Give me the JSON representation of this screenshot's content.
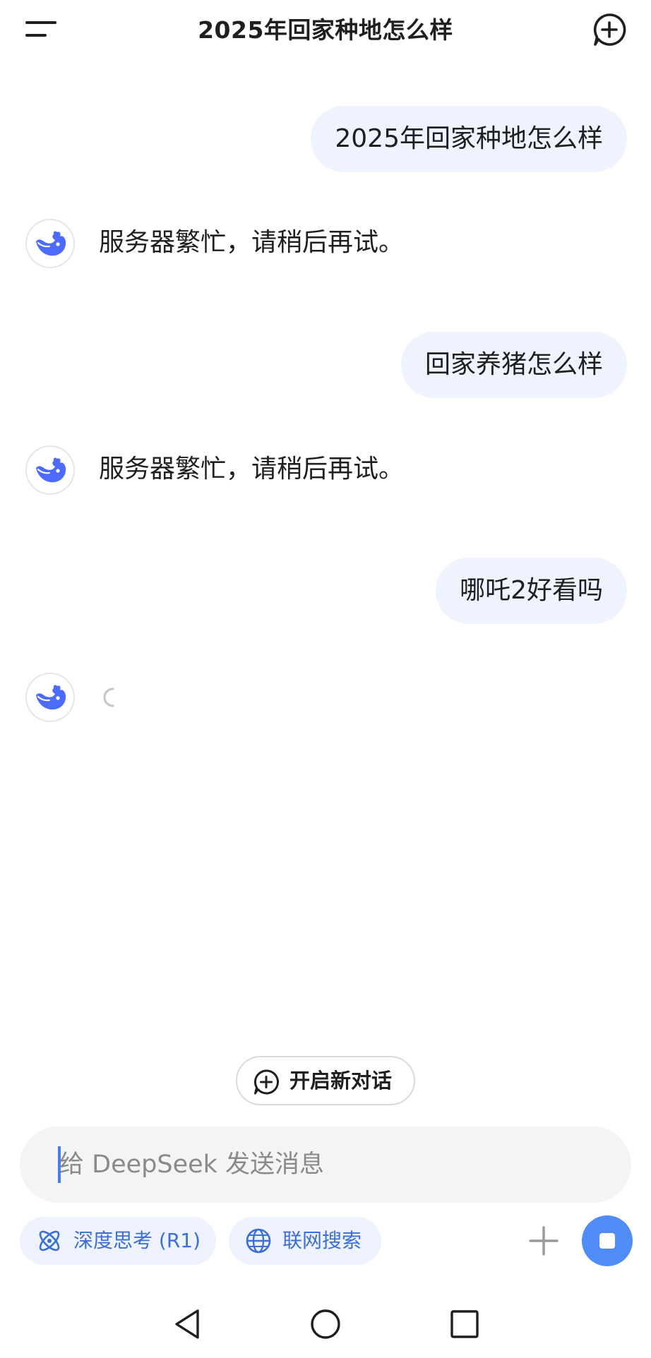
{
  "header": {
    "title": "2025年回家种地怎么样",
    "menu_icon": "menu-icon",
    "new_chat_icon": "chat-plus-icon"
  },
  "messages": [
    {
      "role": "user",
      "text": "2025年回家种地怎么样"
    },
    {
      "role": "assistant",
      "text": "服务器繁忙，请稍后再试。"
    },
    {
      "role": "user",
      "text": "回家养猪怎么样"
    },
    {
      "role": "assistant",
      "text": "服务器繁忙，请稍后再试。"
    },
    {
      "role": "user",
      "text": "哪吒2好看吗"
    },
    {
      "role": "assistant",
      "text": "",
      "state": "loading"
    }
  ],
  "new_conversation": {
    "label": "开启新对话"
  },
  "input": {
    "placeholder": "给 DeepSeek 发送消息"
  },
  "toolbar": {
    "deep_think_label": "深度思考 (R1)",
    "web_search_label": "联网搜索"
  },
  "colors": {
    "accent": "#4f8cf5",
    "user_bubble": "#eef3fd",
    "tool_text": "#3c6fd6",
    "avatar_whale": "#4d6bfe"
  }
}
